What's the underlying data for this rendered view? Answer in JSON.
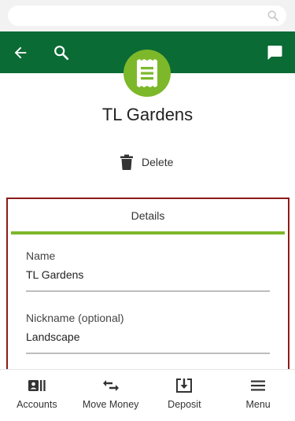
{
  "header": {
    "icons": [
      "back-arrow-icon",
      "search-icon",
      "chat-icon"
    ]
  },
  "payee": {
    "name": "TL Gardens",
    "badge_icon": "receipt-icon"
  },
  "actions": {
    "delete_label": "Delete"
  },
  "details": {
    "tab_label": "Details",
    "name_label": "Name",
    "name_value": "TL Gardens",
    "nickname_label": "Nickname (optional)",
    "nickname_value": "Landscape"
  },
  "bottom_nav": {
    "items": [
      {
        "label": "Accounts",
        "icon": "accounts-icon"
      },
      {
        "label": "Move Money",
        "icon": "transfer-icon"
      },
      {
        "label": "Deposit",
        "icon": "deposit-icon"
      },
      {
        "label": "Menu",
        "icon": "menu-icon"
      }
    ]
  },
  "colors": {
    "header_green": "#0a6b35",
    "accent_lime": "#7db82a",
    "card_border": "#8e1b1b"
  }
}
